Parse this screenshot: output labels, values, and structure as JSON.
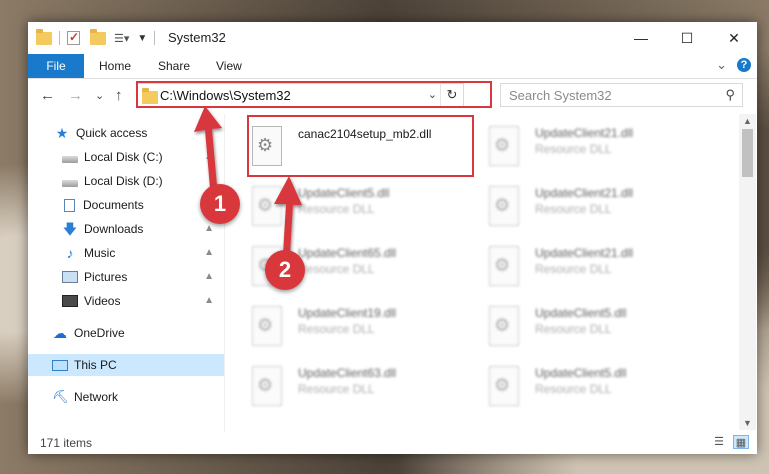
{
  "window": {
    "title": "System32",
    "minimize": "—",
    "maximize": "☐",
    "close": "✕"
  },
  "ribbon": {
    "tabs": [
      "File",
      "Home",
      "Share",
      "View"
    ],
    "expand_chevron": "⌄",
    "help": "?"
  },
  "nav": {
    "back": "←",
    "forward": "→",
    "recent": "⌄",
    "up": "↑"
  },
  "address": {
    "path": "C:\\Windows\\System32",
    "dropdown": "⌄",
    "refresh": "↻"
  },
  "search": {
    "placeholder": "Search System32"
  },
  "sidebar": {
    "items": [
      {
        "label": "Quick access",
        "icon": "star-icon"
      },
      {
        "label": "Local Disk (C:)",
        "icon": "drive-icon"
      },
      {
        "label": "Local Disk (D:)",
        "icon": "drive-icon"
      },
      {
        "label": "Documents",
        "icon": "documents-icon"
      },
      {
        "label": "Downloads",
        "icon": "downloads-icon"
      },
      {
        "label": "Music",
        "icon": "music-icon"
      },
      {
        "label": "Pictures",
        "icon": "pictures-icon"
      },
      {
        "label": "Videos",
        "icon": "videos-icon"
      },
      {
        "label": "OneDrive",
        "icon": "cloud-icon"
      },
      {
        "label": "This PC",
        "icon": "pc-icon"
      },
      {
        "label": "Network",
        "icon": "network-icon"
      }
    ]
  },
  "files": [
    {
      "name": "canac2104setup_mb2.dll",
      "type": ""
    },
    {
      "name": "UpdateClient21.dll",
      "type": "Resource DLL"
    },
    {
      "name": "UpdateClient5.dll",
      "type": "Resource DLL"
    },
    {
      "name": "UpdateClient21.dll",
      "type": "Resource DLL"
    },
    {
      "name": "UpdateClient65.dll",
      "type": "Resource DLL"
    },
    {
      "name": "UpdateClient21.dll",
      "type": "Resource DLL"
    },
    {
      "name": "UpdateClient19.dll",
      "type": "Resource DLL"
    },
    {
      "name": "UpdateClient5.dll",
      "type": "Resource DLL"
    },
    {
      "name": "UpdateClient63.dll",
      "type": "Resource DLL"
    },
    {
      "name": "UpdateClient5.dll",
      "type": "Resource DLL"
    }
  ],
  "status": {
    "item_count": "171 items"
  },
  "annotations": {
    "step1": "1",
    "step2": "2",
    "color": "#d8383c"
  }
}
